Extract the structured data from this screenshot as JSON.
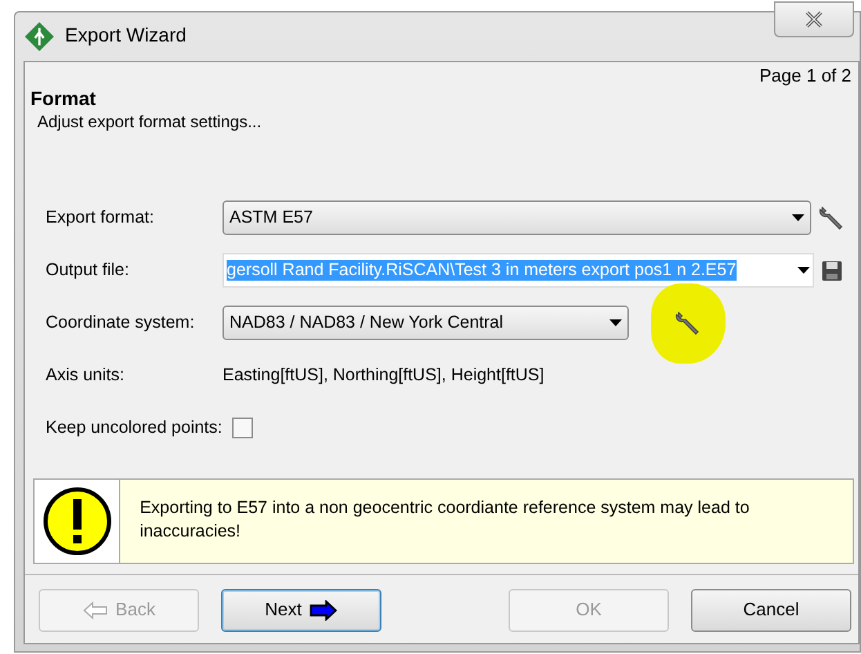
{
  "window": {
    "title": "Export Wizard"
  },
  "header": {
    "page": "Page 1 of 2",
    "title": "Format",
    "subtitle": "Adjust export format settings..."
  },
  "fields": [
    {
      "kind": "combo",
      "label": "Export format:",
      "value": "ASTM E57"
    },
    {
      "kind": "editable",
      "label": "Output file:",
      "value": "gersoll Rand Facility.RiSCAN\\Test 3 in meters export pos1 n 2.E57",
      "selected_text": true
    },
    {
      "kind": "combo-short",
      "label": "Coordinate system:",
      "value": "NAD83 / NAD83 / New York Central",
      "highlighted": true
    },
    {
      "kind": "text",
      "label": "Axis units:",
      "value": "Easting[ftUS], Northing[ftUS], Height[ftUS]"
    },
    {
      "kind": "checkbox",
      "label": "Keep uncolored points:",
      "checked": false
    }
  ],
  "warning": {
    "text": "Exporting to E57 into a non geocentric coordiante reference system may lead to inaccuracies!"
  },
  "buttons": [
    {
      "kind": "back",
      "label": "Back",
      "disabled": true,
      "focused": false
    },
    {
      "kind": "next",
      "label": "Next",
      "disabled": false,
      "focused": true
    },
    {
      "kind": "plain",
      "label": "OK",
      "disabled": true,
      "focused": false
    },
    {
      "kind": "plain",
      "label": "Cancel",
      "disabled": false,
      "focused": false
    }
  ]
}
